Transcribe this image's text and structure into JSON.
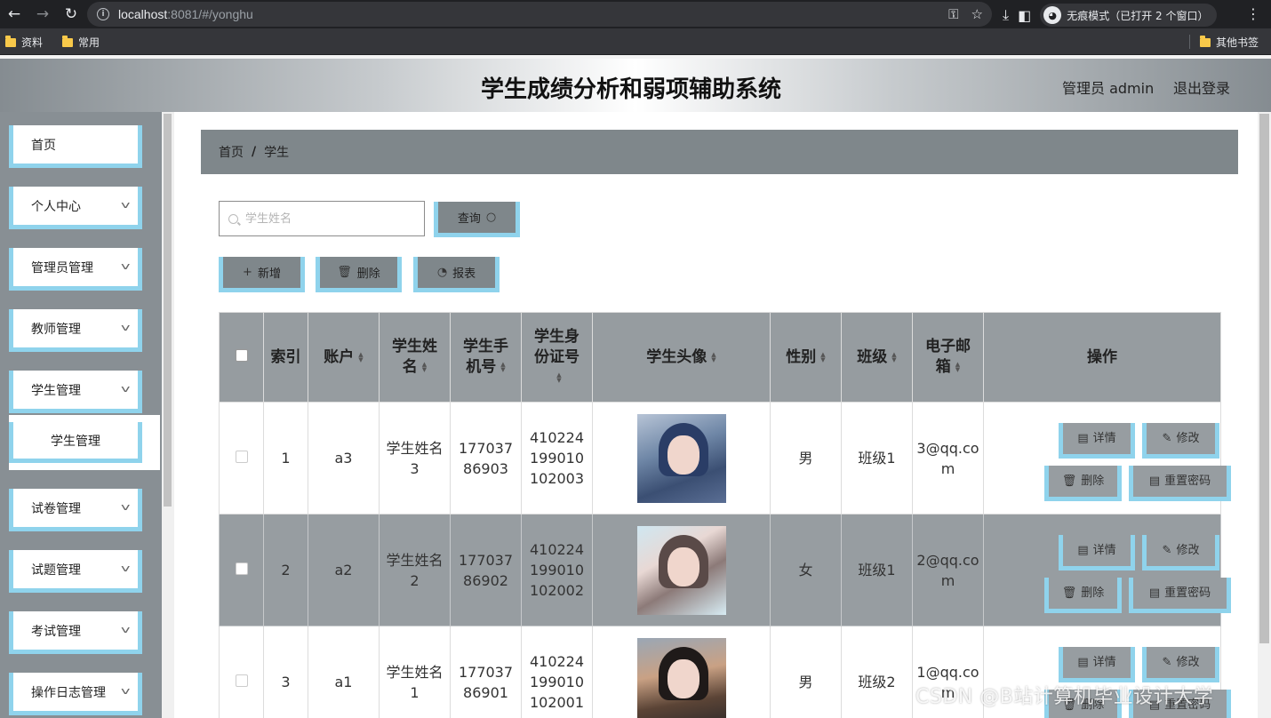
{
  "browser": {
    "url_host": "localhost",
    "url_rest": ":8081/#/yonghu",
    "incognito_label": "无痕模式（已打开 2 个窗口）",
    "bookmarks": [
      "资料",
      "常用"
    ],
    "other_bookmarks": "其他书签"
  },
  "header": {
    "title": "学生成绩分析和弱项辅助系统",
    "user": "管理员 admin",
    "logout": "退出登录"
  },
  "sidebar": {
    "items": [
      {
        "label": "首页"
      },
      {
        "label": "个人中心"
      },
      {
        "label": "管理员管理"
      },
      {
        "label": "教师管理"
      },
      {
        "label": "学生管理"
      },
      {
        "label": "学生管理"
      },
      {
        "label": "试卷管理"
      },
      {
        "label": "试题管理"
      },
      {
        "label": "考试管理"
      },
      {
        "label": "操作日志管理"
      }
    ]
  },
  "breadcrumb": {
    "home": "首页",
    "separator": "/",
    "current": "学生"
  },
  "search": {
    "placeholder": "学生姓名",
    "value": "",
    "button": "查询"
  },
  "actions": {
    "add": "新增",
    "delete": "删除",
    "report": "报表"
  },
  "table": {
    "headers": [
      "索引",
      "账户",
      "学生姓名",
      "学生手机号",
      "学生身份证号",
      "学生头像",
      "性别",
      "班级",
      "电子邮箱",
      "操作"
    ],
    "row_ops": {
      "detail": "详情",
      "edit": "修改",
      "delete": "删除",
      "reset": "重置密码"
    },
    "rows": [
      {
        "index": "1",
        "account": "a3",
        "name": "学生姓名3",
        "phone": "17703786903",
        "idcard": "410224199010102003",
        "gender": "男",
        "class": "班级1",
        "email": "3@qq.com"
      },
      {
        "index": "2",
        "account": "a2",
        "name": "学生姓名2",
        "phone": "17703786902",
        "idcard": "410224199010102002",
        "gender": "女",
        "class": "班级1",
        "email": "2@qq.com"
      },
      {
        "index": "3",
        "account": "a1",
        "name": "学生姓名1",
        "phone": "17703786901",
        "idcard": "410224199010102001",
        "gender": "男",
        "class": "班级2",
        "email": "1@qq.com"
      }
    ]
  },
  "watermark": "CSDN @B站计算机毕业设计大学"
}
